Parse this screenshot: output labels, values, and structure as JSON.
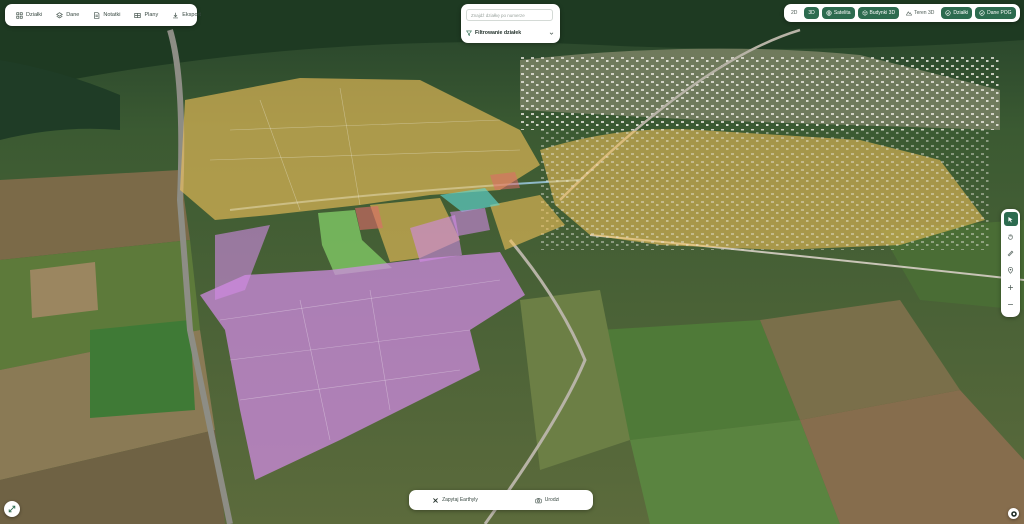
{
  "nav": {
    "items": [
      {
        "label": "Działki",
        "icon": "grid-icon"
      },
      {
        "label": "Dane",
        "icon": "layers-icon"
      },
      {
        "label": "Notatki",
        "icon": "note-icon"
      },
      {
        "label": "Plany",
        "icon": "plan-icon"
      },
      {
        "label": "Eksport",
        "icon": "download-icon"
      }
    ]
  },
  "search": {
    "placeholder": "Znajdź działkę po numerze",
    "filter_label": "Filtrowanie działek"
  },
  "toolbar": {
    "btn_2d": "2D",
    "btn_3d": "3D",
    "satellite": "Satelita",
    "buildings_3d": "Budynki 3D",
    "terrain_3d": "Teren 3D",
    "parcels": "Działki",
    "pog_data": "Dane POG"
  },
  "bottom": {
    "ask": "Zapytaj Earthyly",
    "print": "Urodzi"
  },
  "colors": {
    "accent": "#2c6b4f",
    "zone_residential": "#f2c15a",
    "zone_industrial": "#d28be6",
    "zone_green": "#8ee070",
    "zone_service": "#5fd6d0",
    "zone_red": "#e06a6a"
  }
}
